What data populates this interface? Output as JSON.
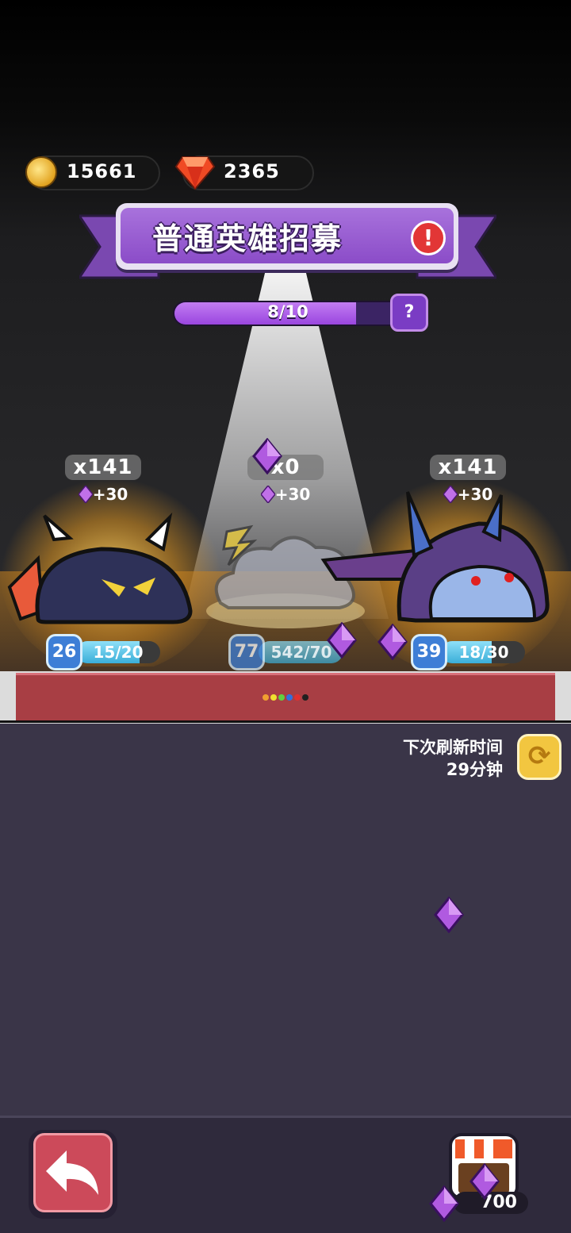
{
  "currency": {
    "gold": {
      "icon": "gold-coin-icon",
      "value": "15661"
    },
    "gems": {
      "icon": "red-gem-icon",
      "value": "2365"
    }
  },
  "banner": {
    "title": "普通英雄招募",
    "alert_icon": "exclamation-icon",
    "alert_symbol": "!"
  },
  "progress": {
    "text": "8/10",
    "fraction": 0.8,
    "help_symbol": "?"
  },
  "heroes": [
    {
      "name_icon": "horned-demon-slime-icon",
      "count": "x141",
      "bonus": "+30",
      "level": "26",
      "shards": "15/20",
      "shard_fraction": 0.75
    },
    {
      "name_icon": "storm-cloud-slime-icon",
      "count": "x0",
      "bonus": "+30",
      "level": "77",
      "shards": "542/70",
      "shard_fraction": 1.0
    },
    {
      "name_icon": "hooded-assassin-slime-icon",
      "count": "x141",
      "bonus": "+30",
      "level": "39",
      "shards": "18/30",
      "shard_fraction": 0.6
    }
  ],
  "page_dots": [
    "#f0a030",
    "#f0e030",
    "#60d040",
    "#3070e0",
    "#e03030",
    "#202020"
  ],
  "refresh": {
    "label": "下次刷新时间",
    "time": "29分钟"
  },
  "shop": {
    "price": "700",
    "icon": "shop-stall-icon"
  },
  "colors": {
    "accent_purple": "#9a46df",
    "banner_purple": "#a872dc",
    "red_bar": "#a83e44",
    "back_button": "#cc4a5a"
  }
}
